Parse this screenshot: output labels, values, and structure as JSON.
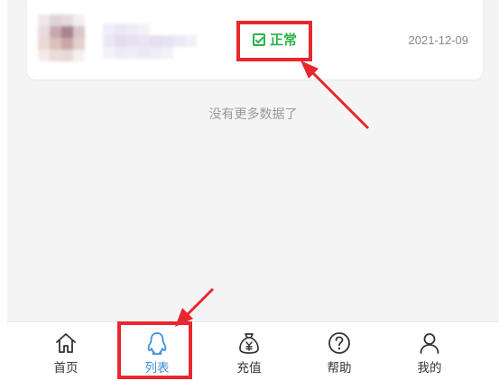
{
  "list": {
    "items": [
      {
        "status_label": "正常",
        "status_icon": "checkbox-checked-icon",
        "date": "2021-12-09"
      }
    ],
    "no_more_text": "没有更多数据了"
  },
  "tabbar": {
    "active_index": 1,
    "tabs": [
      {
        "label": "首页",
        "icon": "home-icon"
      },
      {
        "label": "列表",
        "icon": "qq-penguin-icon"
      },
      {
        "label": "充值",
        "icon": "money-bag-icon"
      },
      {
        "label": "帮助",
        "icon": "help-circle-icon"
      },
      {
        "label": "我的",
        "icon": "user-icon"
      }
    ]
  },
  "colors": {
    "status_green": "#2db24b",
    "annotation_red": "#e8272e",
    "active_blue": "#3d8fe0",
    "page_bg": "#f4f4f4"
  }
}
